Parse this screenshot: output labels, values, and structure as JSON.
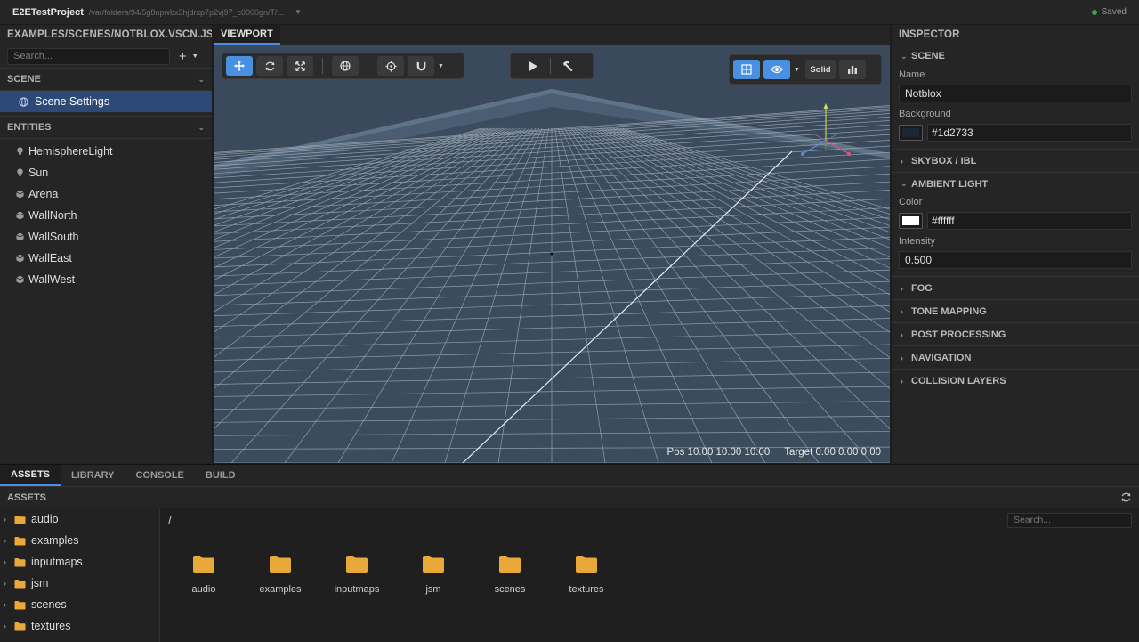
{
  "titlebar": {
    "project": "E2ETestProject",
    "path": "/var/folders/94/5g8npwbx3hjdrxp7p2vj97_c0000gn/T/...",
    "status": "Saved"
  },
  "left": {
    "file_title": "EXAMPLES/SCENES/NOTBLOX.VSCN.JSON",
    "search_placeholder": "Search...",
    "scene_section": "SCENE",
    "scene_settings": "Scene Settings",
    "entities_section": "ENTITIES",
    "entities": [
      {
        "name": "HemisphereLight",
        "icon": "light-bulb-icon"
      },
      {
        "name": "Sun",
        "icon": "light-bulb-icon"
      },
      {
        "name": "Arena",
        "icon": "cube-icon"
      },
      {
        "name": "WallNorth",
        "icon": "cube-icon"
      },
      {
        "name": "WallSouth",
        "icon": "cube-icon"
      },
      {
        "name": "WallEast",
        "icon": "cube-icon"
      },
      {
        "name": "WallWest",
        "icon": "cube-icon"
      }
    ]
  },
  "viewport": {
    "tab": "VIEWPORT",
    "solid_label": "Solid",
    "pos": "Pos 10.00 10.00 10.00",
    "target": "Target 0.00 0.00 0.00"
  },
  "inspector": {
    "title": "INSPECTOR",
    "scene": {
      "title": "SCENE",
      "name_label": "Name",
      "name_value": "Notblox",
      "bg_label": "Background",
      "bg_value": "#1d2733"
    },
    "skybox": "SKYBOX / IBL",
    "ambient": {
      "title": "AMBIENT LIGHT",
      "color_label": "Color",
      "color_value": "#ffffff",
      "intensity_label": "Intensity",
      "intensity_value": "0.500"
    },
    "collapsed": [
      "FOG",
      "TONE MAPPING",
      "POST PROCESSING",
      "NAVIGATION",
      "COLLISION LAYERS"
    ]
  },
  "bottom": {
    "tabs": [
      "ASSETS",
      "LIBRARY",
      "CONSOLE",
      "BUILD"
    ],
    "assets_title": "ASSETS",
    "tree": [
      "audio",
      "examples",
      "inputmaps",
      "jsm",
      "scenes",
      "textures"
    ],
    "breadcrumb": "/",
    "search_placeholder": "Search...",
    "files": [
      "audio",
      "examples",
      "inputmaps",
      "jsm",
      "scenes",
      "textures"
    ]
  },
  "colors": {
    "accent": "#4a90e2",
    "folder": "#e8a93a",
    "selection": "#2d4a77",
    "saved": "#43a047"
  }
}
